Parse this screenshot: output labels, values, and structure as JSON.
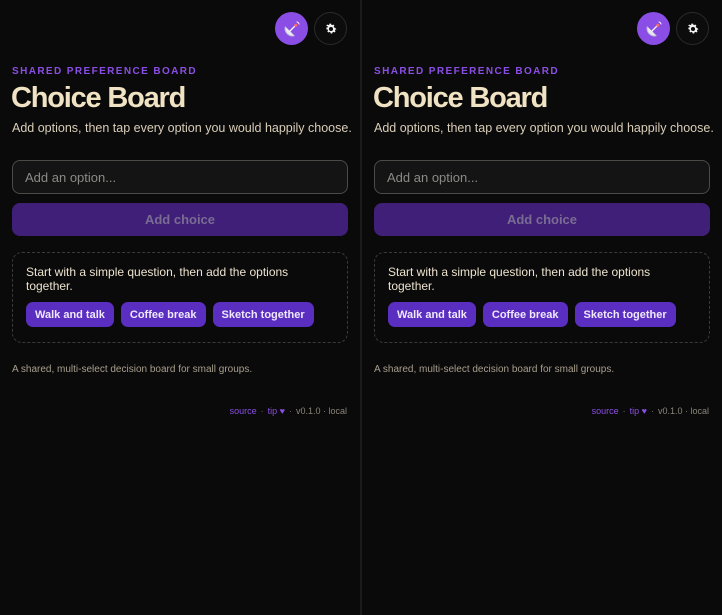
{
  "panels": [
    {
      "eyebrow": "SHARED PREFERENCE BOARD",
      "title": "Choice Board",
      "subtitle": "Add options, then tap every option you would happily choose.",
      "input": {
        "placeholder": "Add an option..."
      },
      "add_button": "Add choice",
      "hint": "Start with a simple question, then add the options together.",
      "chips": [
        "Walk and talk",
        "Coffee break",
        "Sketch together"
      ],
      "footnote": "A shared, multi-select decision board for small groups.",
      "meta": {
        "source": "source",
        "tip": "tip",
        "heart": "♥",
        "version": "v0.1.0 · local",
        "sep": "·"
      }
    },
    {
      "eyebrow": "SHARED PREFERENCE BOARD",
      "title": "Choice Board",
      "subtitle": "Add options, then tap every option you would happily choose.",
      "input": {
        "placeholder": "Add an option..."
      },
      "add_button": "Add choice",
      "hint": "Start with a simple question, then add the options together.",
      "chips": [
        "Walk and talk",
        "Coffee break",
        "Sketch together"
      ],
      "footnote": "A shared, multi-select decision board for small groups.",
      "meta": {
        "source": "source",
        "tip": "tip",
        "heart": "♥",
        "version": "v0.1.0 · local",
        "sep": "·"
      }
    }
  ],
  "icons": {
    "primary": "satellite-dish-icon",
    "settings": "gear-icon"
  },
  "colors": {
    "accent": "#8a4ee6",
    "chip": "#5a2ec0",
    "button": "#3f1f78",
    "title": "#f0e3c4",
    "background": "#0b0a0a"
  }
}
